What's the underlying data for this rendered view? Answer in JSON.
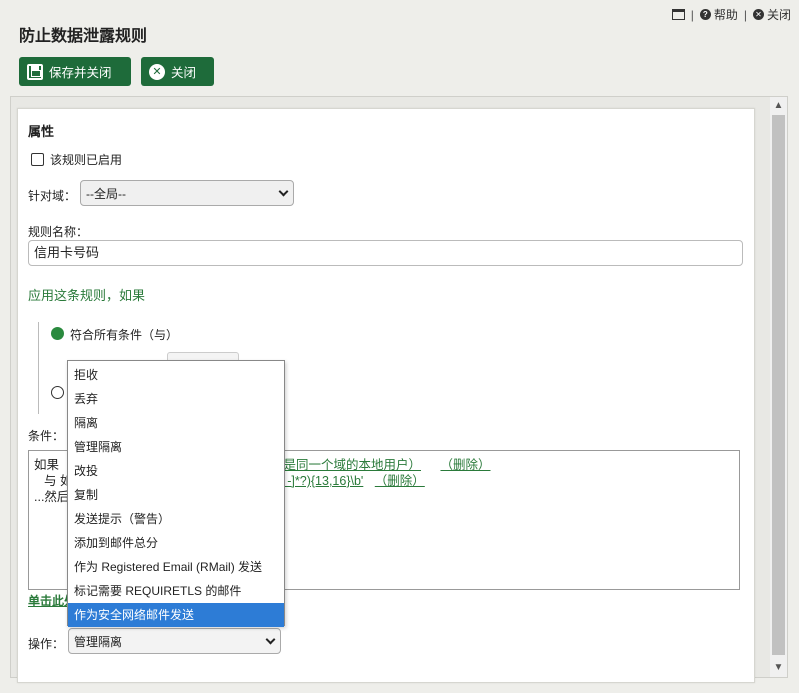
{
  "topbar": {
    "help": "帮助",
    "close": "关闭",
    "sep": "|"
  },
  "page_title": "防止数据泄露规则",
  "toolbar": {
    "save_close": "保存并关闭",
    "close": "关闭"
  },
  "properties": {
    "heading": "属性",
    "enabled_label": "该规则已启用",
    "domain_label": "针对域：",
    "domain_value": "--全局--",
    "rule_name_label": "规则名称：",
    "rule_name_value": "信用卡号码",
    "apply_heading": "应用这条规则，如果",
    "match_all_label": "符合所有条件（与）",
    "conditions_label": "条件："
  },
  "conditions": {
    "line1_prefix": "如果",
    "line1_link_fragment": "件人不是同一个域的本地用户）",
    "line1_delete": "（删除）",
    "line2_prefix": "与 如",
    "line2_link_fragment": "?:\\d[ -]*?){13,16}\\b'",
    "line2_delete": "（删除）",
    "line3_prefix": "...然后",
    "add_link_fragment": "单击此处"
  },
  "action": {
    "label": "操作：",
    "value": "管理隔离"
  },
  "dropdown_menu": {
    "items": [
      "拒收",
      "丢弃",
      "隔离",
      "管理隔离",
      "改投",
      "复制",
      "发送提示（警告）",
      "添加到邮件总分",
      "作为 Registered Email (RMail) 发送",
      "标记需要 REQUIRETLS 的邮件",
      "作为安全网络邮件发送"
    ],
    "highlighted": "作为安全网络邮件发送"
  },
  "colors": {
    "accent_green": "#1e6b3a",
    "link_green": "#2a7a3a",
    "menu_highlight": "#2d7cd6"
  }
}
